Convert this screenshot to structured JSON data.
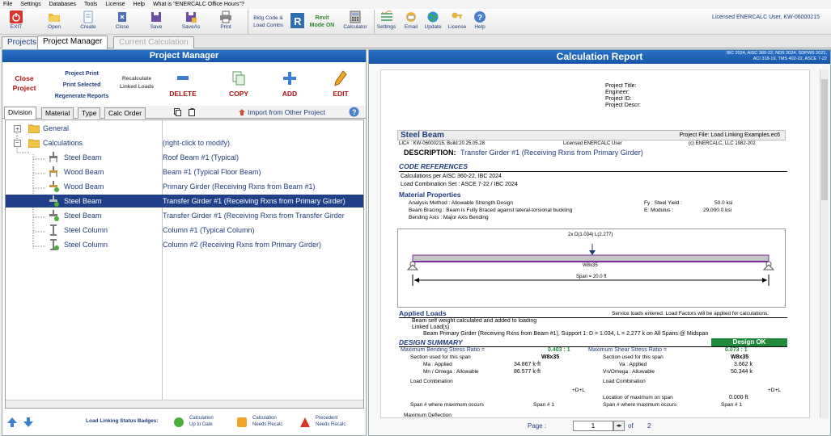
{
  "menu": [
    "File",
    "Settings",
    "Databases",
    "Tools",
    "License",
    "Help",
    "What is \"ENERCALC Office Hours\"?"
  ],
  "toolbar": {
    "exit": "EXIT",
    "open": "Open",
    "create": "Create",
    "close": "Close",
    "save": "Save",
    "saveas": "SaveAs",
    "print": "Print",
    "bldg_code_1": "Bldg Code &",
    "bldg_code_2": "Load Combs",
    "revit_1": "Revit",
    "revit_2": "Mode ON",
    "calculator": "Calculator",
    "settings": "Settings",
    "email": "Email",
    "update": "Update",
    "license": "License",
    "help": "Help",
    "licensed_user": "Licensed ENERCALC User, KW-06000215"
  },
  "main_tabs": [
    "Projects",
    "Project Manager",
    "Current Calculation"
  ],
  "project_manager": {
    "title": "Project Manager",
    "close_project_1": "Close",
    "close_project_2": "Project",
    "project_print": "Project Print",
    "print_selected": "Print Selected",
    "regenerate_reports": "Regenerate Reports",
    "recalc_1": "Recalculate",
    "recalc_2": "Linked Loads",
    "delete": "DELETE",
    "copy": "COPY",
    "add": "ADD",
    "edit": "EDIT",
    "subtabs": [
      "Division",
      "Material",
      "Type",
      "Calc Order"
    ],
    "import": "Import from Other Project",
    "tree": [
      {
        "name": "General",
        "desc": ""
      },
      {
        "name": "Calculations",
        "desc": "(right-click to modify)"
      },
      {
        "name": "Steel Beam",
        "desc": "Roof Beam #1 (Typical)"
      },
      {
        "name": "Wood Beam",
        "desc": "Beam #1 (Typical Floor Beam)"
      },
      {
        "name": "Wood Beam",
        "desc": "Primary Girder (Receiving Rxns from Beam #1)"
      },
      {
        "name": "Steel Beam",
        "desc": "Transfer Girder #1 (Receiving Rxns from Primary Girder)"
      },
      {
        "name": "Steel Beam",
        "desc": "Transfer Girder #1 (Receiving Rxns from Transfer Girder"
      },
      {
        "name": "Steel Column",
        "desc": "Column #1 (Typical Column)"
      },
      {
        "name": "Steel Column",
        "desc": "Column #2 (Receiving Rxns from Primary Girder)"
      }
    ],
    "badges_label": "Load Linking Status Badges:",
    "badge_uptodate_1": "Calculation",
    "badge_uptodate_2": "Up to Date",
    "badge_recalc_1": "Calculation",
    "badge_recalc_2": "Needs Recalc",
    "badge_precedent_1": "Precedent",
    "badge_precedent_2": "Needs Recalc"
  },
  "report": {
    "title": "Calculation Report",
    "codes_1": "IBC 2024, AISC 360-22, NDS 2024, SDPWS 2021,",
    "codes_2": "ACI 318-19, TMS 402-22, ASCE 7-22",
    "project_fields": [
      "Project Title:",
      "Engineer:",
      "Project ID:",
      "Project Descr:"
    ],
    "calc_type": "Steel Beam",
    "project_file": "Project File: Load Linking Examples.ec6",
    "lic_line": "LIC# : KW-06000215, Build:20.25.05.28",
    "lic_user": "Licensed ENERCALC User",
    "copyright": "(c) ENERCALC, LLC 1982-202",
    "description_label": "DESCRIPTION:",
    "description": "Transfer Girder #1 (Receiving Rxns from Primary Girder)",
    "code_refs": "CODE REFERENCES",
    "calcs_per": "Calculations per AISC 360-22, IBC 2024",
    "load_combo_set": "Load Combination Set : ASCE 7-22 / IBC 2024",
    "material_props": "Material Properties",
    "analysis_method": "Analysis Method :  Allowable Strength Design",
    "beam_bracing": "Beam Bracing :     Beam is Fully Braced against lateral-torsional buckling",
    "bending_axis": "Bending Axis :      Major Axis Bending",
    "fy": "Fy : Steel Yield :",
    "fy_val": "50.0 ksi",
    "emod": "E: Modulus :",
    "emod_val": "29,000.0 ksi",
    "load_label": "2x D(1.034) L(2.277)",
    "section": "W8x35",
    "span": "Span = 20.0 ft",
    "applied_loads": "Applied Loads",
    "service_note": "Service loads entered. Load Factors will be applied for calculations.",
    "self_weight": "Beam self weight calculated and added to loading",
    "linked_loads": "Linked Load(s)",
    "linked_line": "Beam Primary Girder (Receiving Rxns from Beam #1), Support 1: D = 1.034,  L = 2.277 k on All Spans  @ Midspan",
    "design_summary": "DESIGN SUMMARY",
    "design_ok": "Design OK",
    "max_bending": "Maximum Bending Stress Ratio   =",
    "max_bending_val": "0.403 : 1",
    "max_shear": "Maximum Shear Stress Ratio =",
    "max_shear_val": "0.073 : 1",
    "section_used": "Section used for this span",
    "ma": "Ma : Applied",
    "ma_val": "34.867 k-ft",
    "mn": "Mn / Omega : Allowable",
    "mn_val": "86.577 k-ft",
    "va": "Va : Applied",
    "va_val": "3.662 k",
    "vn": "Vn/Omega : Allowable",
    "vn_val": "50.344 k",
    "load_combination": "Load Combination",
    "dl": "+D+L",
    "location_max": "Location of maximum on span",
    "location_val": "0.000 ft",
    "span_max": "Span # where maximum occurs",
    "span_num": "Span # 1",
    "max_deflection": "Maximum Deflection",
    "page_label": "Page :",
    "page_current": "1",
    "page_of": "of",
    "page_total": "2"
  }
}
